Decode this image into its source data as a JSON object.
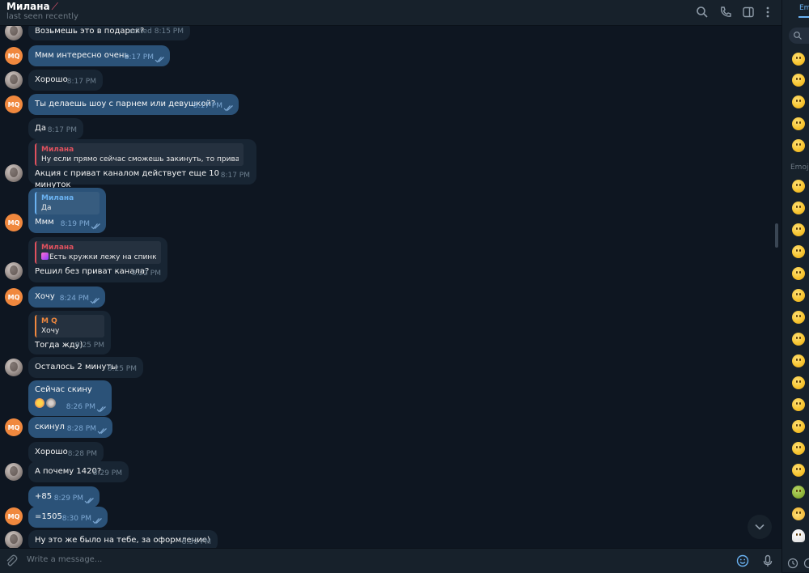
{
  "header": {
    "name": "Милана",
    "status": "last seen recently"
  },
  "messages": [
    {
      "id": "m1",
      "side": "in",
      "text": "Возьмешь это в подарок?",
      "time": "edited 8:15 PM"
    },
    {
      "id": "m2",
      "side": "out",
      "text": "Ммм интересно очень",
      "time": "8:17 PM"
    },
    {
      "id": "m3",
      "side": "in",
      "text": "Хорошо",
      "time": "8:17 PM"
    },
    {
      "id": "m4",
      "side": "out",
      "text": "Ты делаешь шоу с парнем или девушкой?",
      "time": "8:17 PM"
    },
    {
      "id": "m5",
      "side": "in",
      "text": "Да",
      "time": "8:17 PM"
    },
    {
      "id": "m6",
      "side": "in",
      "reply_name": "Милана",
      "reply_text": "Ну если прямо сейчас сможешь закинуть, то приват ка...",
      "text": "Акция с приват каналом действует еще 10 минуток",
      "time": "8:17 PM"
    },
    {
      "id": "m7",
      "side": "out",
      "reply_name": "Милана",
      "reply_text": "Да",
      "text": "Ммм",
      "time": "8:19 PM"
    },
    {
      "id": "m8",
      "side": "in",
      "reply_name": "Милана",
      "reply_text": "Есть кружки лежу на спинке...",
      "text": "Решил без приват канала?",
      "time": "8:22 PM"
    },
    {
      "id": "m9",
      "side": "out",
      "text": "Хочу",
      "time": "8:24 PM"
    },
    {
      "id": "m10",
      "side": "in",
      "reply_name": "M Q",
      "reply_text": "Хочу",
      "text": "Тогда жду)",
      "time": "8:25 PM"
    },
    {
      "id": "m11",
      "side": "in",
      "text": "Осталось 2 минуты",
      "time": "8:25 PM"
    },
    {
      "id": "m12",
      "side": "out",
      "text": "Сейчас скину",
      "time": "8:26 PM"
    },
    {
      "id": "m13",
      "side": "out",
      "text": "скинул",
      "time": "8:28 PM"
    },
    {
      "id": "m14",
      "side": "in",
      "text": "Хорошо",
      "time": "8:28 PM"
    },
    {
      "id": "m15",
      "side": "in",
      "text": "А почему 1420?",
      "time": "8:29 PM"
    },
    {
      "id": "m16",
      "side": "out",
      "text": "+85",
      "time": "8:29 PM"
    },
    {
      "id": "m17",
      "side": "out",
      "text": "=1505",
      "time": "8:30 PM"
    },
    {
      "id": "m18",
      "side": "in",
      "text": "Ну это же было на тебе, за оформление)",
      "time": "8:30 PM"
    }
  ],
  "avatar_mq": "MQ",
  "input": {
    "placeholder": "Write a message..."
  },
  "emoji_panel": {
    "tab_label": "Emoji",
    "section_label": "Emoji"
  },
  "colors": {
    "bg": "#0e1621",
    "incoming": "#182533",
    "outgoing": "#2b5278",
    "accent": "#6ab2f2",
    "mq_avatar": "#f0883e"
  },
  "icons": [
    "search-icon",
    "phone-icon",
    "sidebar-icon",
    "more-icon",
    "paperclip-icon",
    "emoji-icon",
    "microphone-icon",
    "chevron-down-icon",
    "clock-icon"
  ]
}
